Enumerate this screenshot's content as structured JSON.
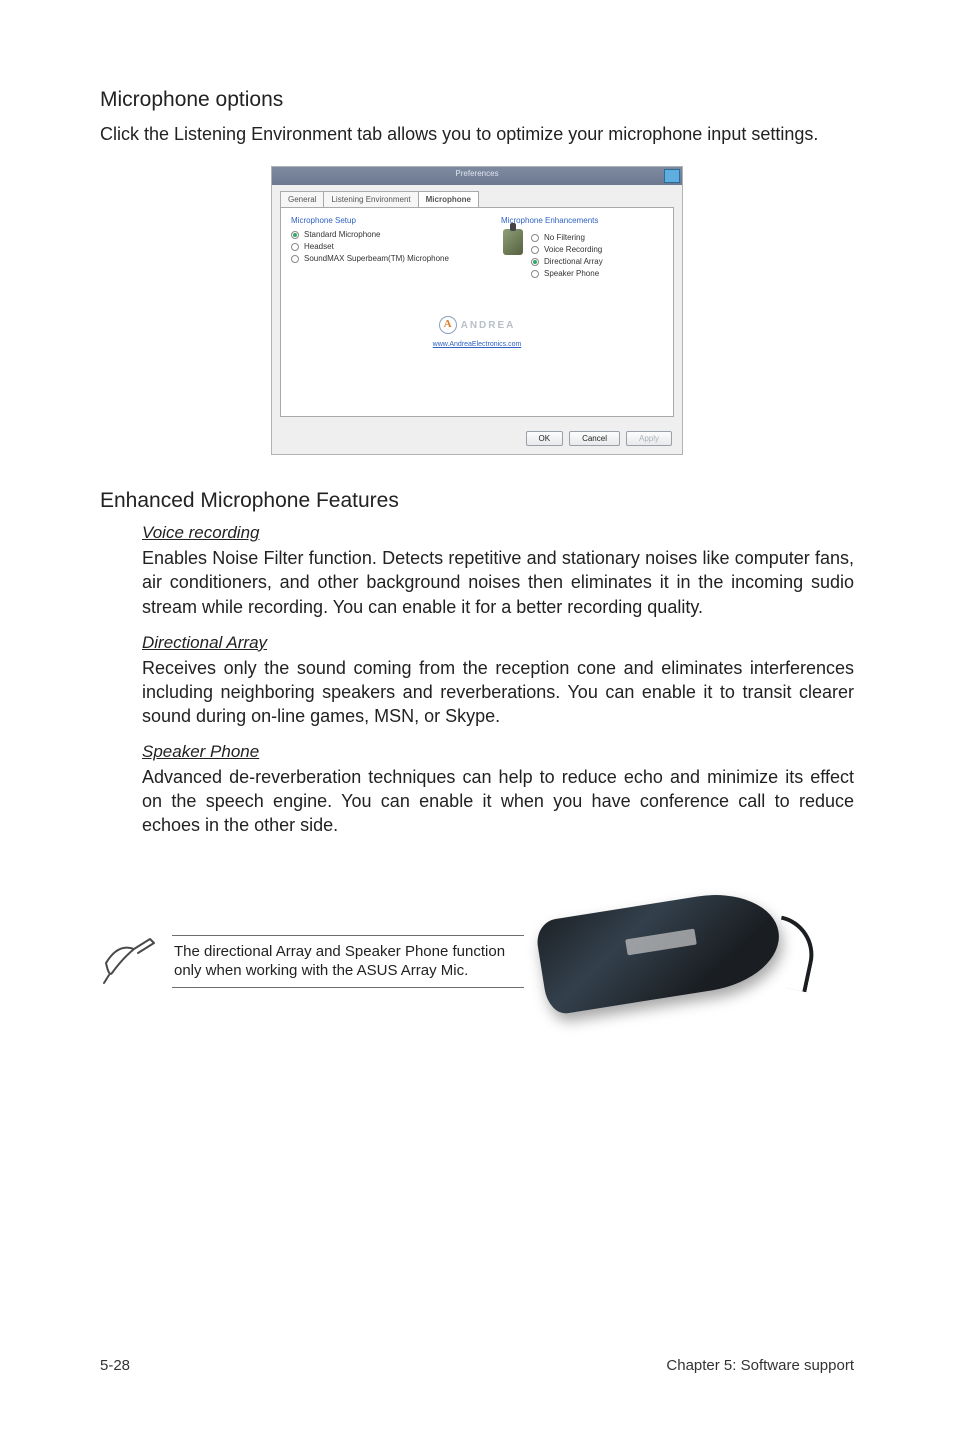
{
  "section1": {
    "heading": "Microphone options",
    "body": "Click the Listening Environment tab allows you to optimize your microphone input settings."
  },
  "dialog": {
    "title": "Preferences",
    "tabs": [
      "General",
      "Listening Environment",
      "Microphone"
    ],
    "active_tab_index": 2,
    "left": {
      "header": "Microphone Setup",
      "options": [
        "Standard Microphone",
        "Headset",
        "SoundMAX Superbeam(TM) Microphone"
      ],
      "selected_index": 0
    },
    "right": {
      "header": "Microphone Enhancements",
      "options": [
        "No Filtering",
        "Voice Recording",
        "Directional Array",
        "Speaker Phone"
      ],
      "selected_index": 2
    },
    "logo_text": "ANDREA",
    "logo_url": "www.AndreaElectronics.com",
    "buttons": {
      "ok": "OK",
      "cancel": "Cancel",
      "apply": "Apply"
    }
  },
  "section2": {
    "heading": "Enhanced Microphone Features",
    "features": [
      {
        "title": "Voice recording",
        "body": "Enables Noise Filter function. Detects repetitive and stationary noises like computer fans, air conditioners, and other background noises then eliminates it in the incoming sudio stream while recording. You can enable it for a better recording quality."
      },
      {
        "title": "Directional Array",
        "body": "Receives only the sound coming from the reception cone and eliminates interferences including neighboring speakers and reverberations. You can enable it to transit clearer sound during on-line games, MSN, or Skype."
      },
      {
        "title": "Speaker Phone",
        "body": "Advanced de-reverberation techniques can help to reduce echo and minimize its effect on the speech engine. You can enable it when you have conference call to reduce echoes in the other side."
      }
    ]
  },
  "note": "The directional Array and Speaker Phone function only when working with the ASUS Array Mic.",
  "footer": {
    "page": "5-28",
    "chapter": "Chapter 5: Software support"
  }
}
